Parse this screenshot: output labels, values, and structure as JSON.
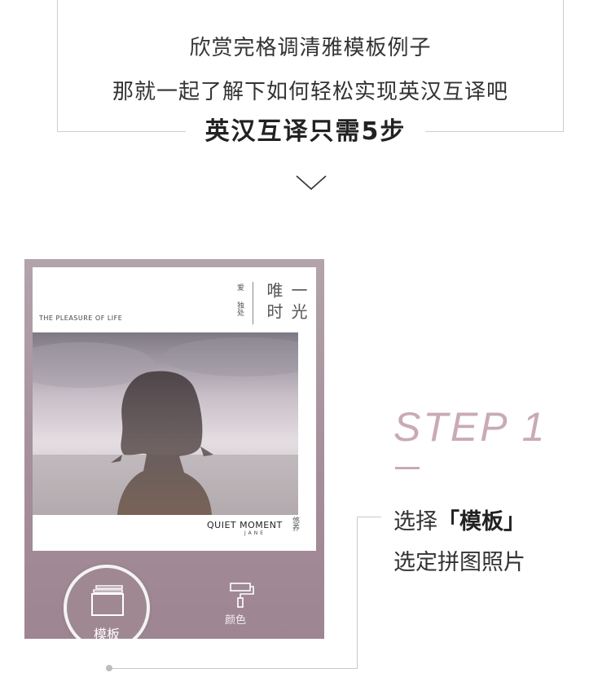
{
  "intro": {
    "line1": "欣赏完格调清雅模板例子",
    "line2": "那就一起了解下如何轻松实现英汉互译吧",
    "headline": "英汉互译只需5步"
  },
  "poster": {
    "subtitle": "THE PLEASURE OF  LIFE",
    "vertical_small_1": "爱",
    "vertical_small_2": "独处",
    "title_col1": "唯时",
    "title_col2": "一光",
    "footer_title": "QUIET MOMENT",
    "footer_author": "JANE",
    "footer_tag": "悠养"
  },
  "toolbar": {
    "template_label": "模板",
    "color_label": "颜色"
  },
  "step": {
    "title": "STEP  1",
    "line1_prefix": "选择",
    "line1_open": "「",
    "line1_keyword": "模板",
    "line1_close": "」",
    "line2": "选定拼图照片"
  },
  "colors": {
    "accent": "#c9aab6",
    "preview_bg": "#a58f9a"
  }
}
